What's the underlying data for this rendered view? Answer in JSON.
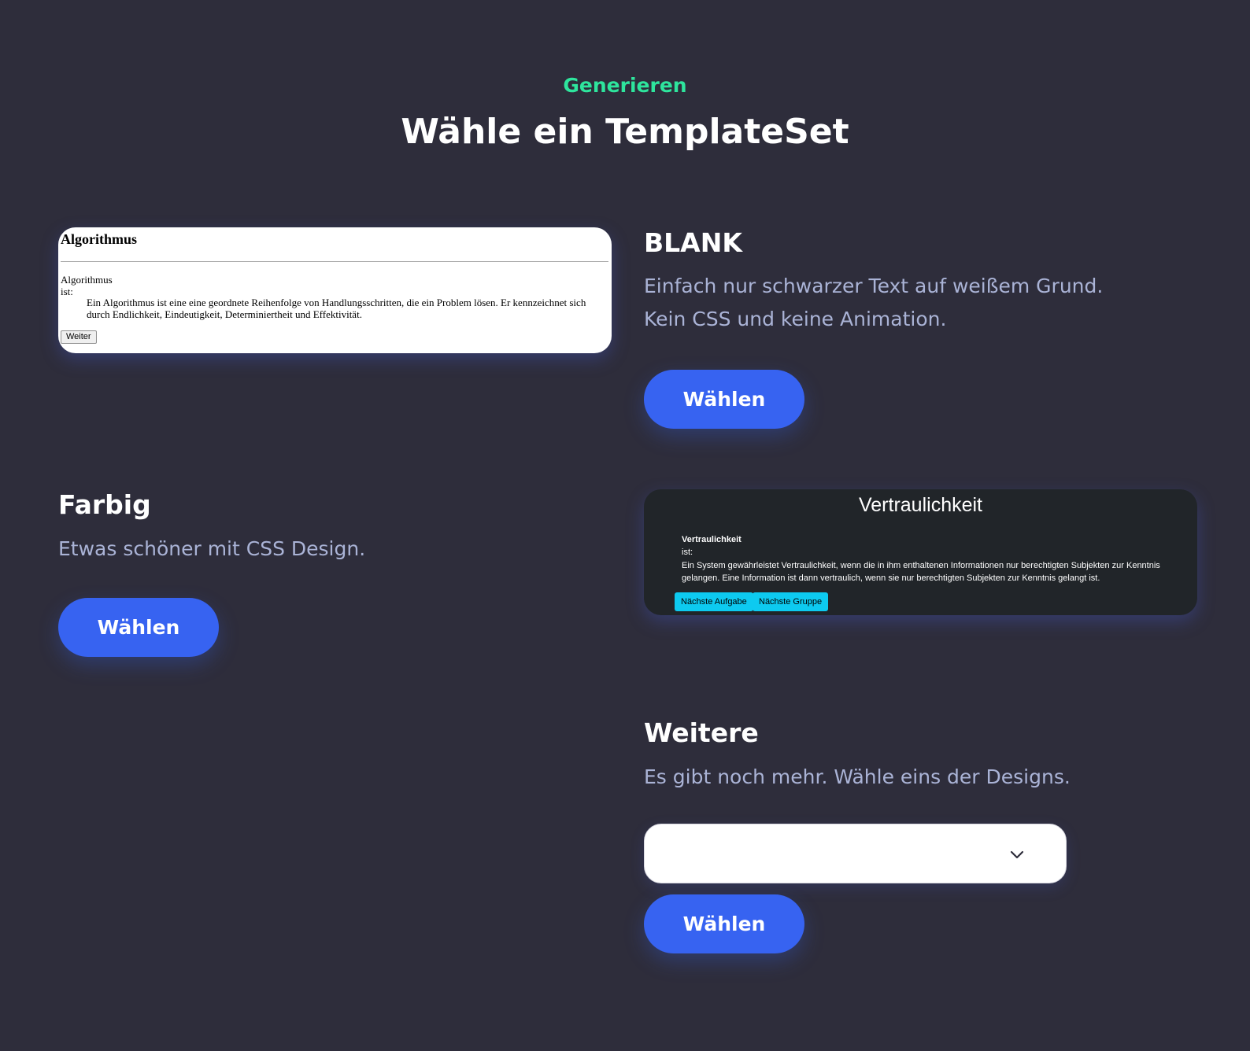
{
  "header": {
    "eyebrow": "Generieren",
    "title": "Wähle ein TemplateSet"
  },
  "blank": {
    "title": "BLANK",
    "desc_line1": "Einfach nur schwarzer Text auf weißem Grund.",
    "desc_line2": "Kein CSS und keine Animation.",
    "button": "Wählen",
    "preview": {
      "heading": "Algorithmus",
      "term": "Algorithmus",
      "ist": "ist:",
      "definition": "Ein Algorithmus ist eine eine geordnete Reihenfolge von Handlungsschritten, die ein Problem lösen. Er kennzeichnet sich durch Endlichkeit, Eindeutigkeit, Determiniertheit und Effektivität.",
      "button": "Weiter"
    }
  },
  "farbig": {
    "title": "Farbig",
    "desc": "Etwas schöner mit CSS Design.",
    "button": "Wählen",
    "preview": {
      "heading": "Vertraulichkeit",
      "term": "Vertraulichkeit",
      "ist": "ist:",
      "definition": "Ein System gewährleistet Vertraulichkeit, wenn die in ihm enthaltenen Informationen nur berechtigten Subjekten zur Kenntnis gelangen. Eine Information ist dann vertraulich, wenn sie nur berechtigten Subjekten zur Kenntnis gelangt ist.",
      "button_next_task": "Nächste Aufgabe",
      "button_next_group": "Nächste Gruppe"
    }
  },
  "weitere": {
    "title": "Weitere",
    "desc": "Es gibt noch mehr. Wähle eins der Designs.",
    "select_value": "",
    "button": "Wählen"
  },
  "colors": {
    "background": "#2e2d3b",
    "accent_green": "#2ee59d",
    "button_blue": "#3763f1",
    "desc_text": "#aab3d6",
    "preview_dark": "#212529",
    "preview_button_cyan": "#0dcaf0"
  },
  "icons": {
    "select_chevron": "chevron-down-icon"
  }
}
